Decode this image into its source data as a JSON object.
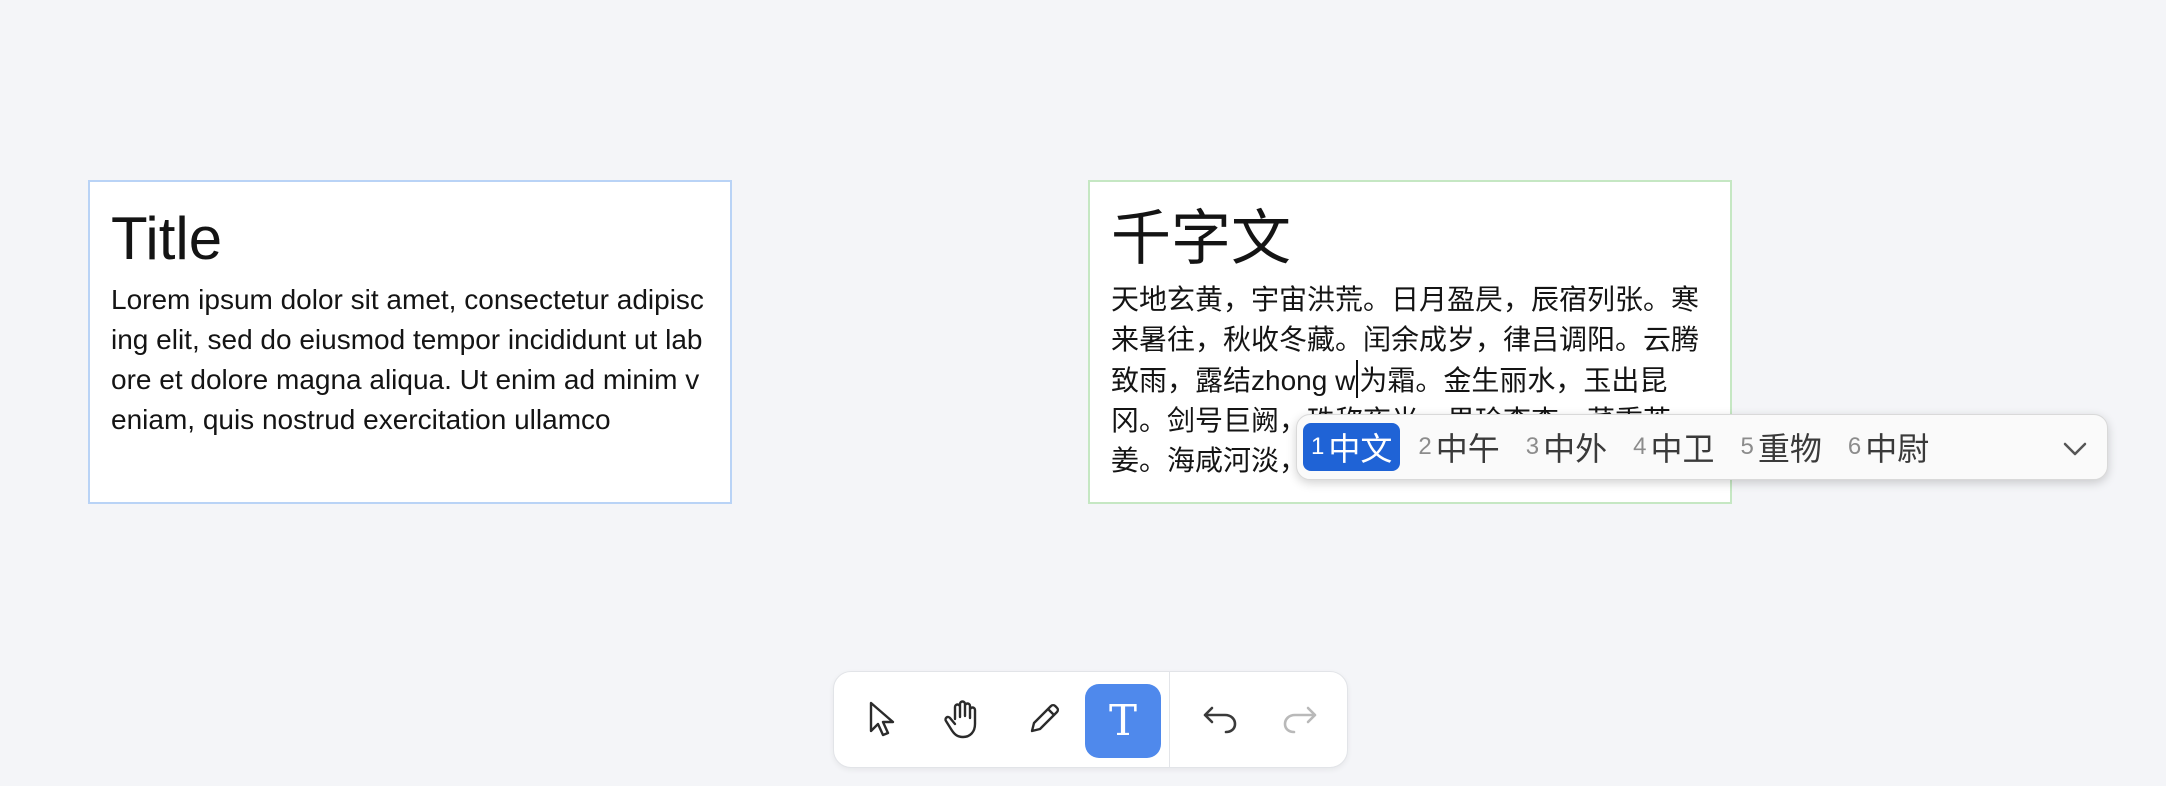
{
  "cards": {
    "left": {
      "title": "Title",
      "body": "Lorem ipsum dolor sit amet, consectetur adipiscing elit, sed do eiusmod tempor incididunt ut labore et dolore magna aliqua. Ut enim ad minim veniam, quis nostrud exercitation ullamco"
    },
    "right": {
      "title": "千字文",
      "body_before": "天地玄黄，宇宙洪荒。日月盈昃，辰宿列张。寒来暑往，秋收冬藏。闰余成岁，律吕调阳。云腾致雨，露结",
      "composing": "zhong w",
      "body_after": "为霜。金生丽水，玉出昆冈。剑号巨阙，珠称夜光。果珍李柰，菜重芥姜。海咸河淡，鳞潜羽翔。"
    }
  },
  "ime": {
    "candidates": [
      {
        "num": "1",
        "word": "中文"
      },
      {
        "num": "2",
        "word": "中午"
      },
      {
        "num": "3",
        "word": "中外"
      },
      {
        "num": "4",
        "word": "中卫"
      },
      {
        "num": "5",
        "word": "重物"
      },
      {
        "num": "6",
        "word": "中尉"
      }
    ],
    "selected_index": 0,
    "expand_icon": "chevron-down-icon"
  },
  "toolbar": {
    "tools": [
      {
        "name": "select",
        "icon": "cursor-arrow-icon"
      },
      {
        "name": "hand",
        "icon": "hand-icon"
      },
      {
        "name": "draw",
        "icon": "pencil-icon"
      },
      {
        "name": "text",
        "icon": "text-icon",
        "glyph": "T",
        "active": true
      },
      {
        "name": "undo",
        "icon": "undo-icon"
      },
      {
        "name": "redo",
        "icon": "redo-icon",
        "disabled": true
      }
    ],
    "accent_color": "#4f89ec"
  },
  "colors": {
    "background": "#f4f5f8",
    "left_card_border": "#b9d3f6",
    "right_card_border": "#c5e7c3",
    "ime_selected": "#1f63d6"
  }
}
